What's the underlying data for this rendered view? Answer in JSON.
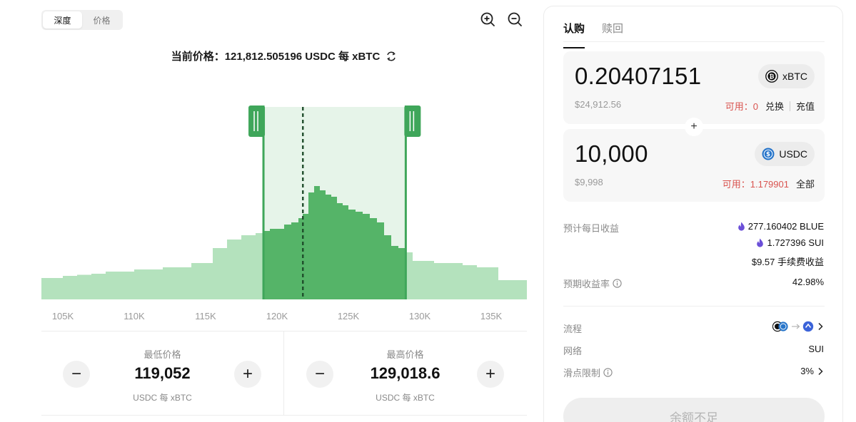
{
  "view_toggle": {
    "options": [
      "深度",
      "价格"
    ],
    "active": "深度"
  },
  "zoom": {
    "in_icon": "zoom-in-icon",
    "out_icon": "zoom-out-icon"
  },
  "current_price": {
    "text": "当前价格：121,812.505196 USDC 每 xBTC",
    "icon": "swap-arrows-icon"
  },
  "chart_data": {
    "type": "area",
    "x_ticks": [
      "105K",
      "110K",
      "115K",
      "120K",
      "125K",
      "130K",
      "135K"
    ],
    "xlim": [
      103500,
      137500
    ],
    "selected_range": [
      119052,
      129018.6
    ],
    "current_price": 121812.505196,
    "colors": {
      "outside": "#b4e2bd",
      "inside": "#55b468",
      "handle": "#3fa65a",
      "band": "#e6f4e9",
      "current_line": "#1f4d2b"
    },
    "depth": {
      "x": [
        103500,
        105000,
        106000,
        107000,
        108000,
        110000,
        112000,
        114000,
        115500,
        116500,
        117500,
        118500,
        119000,
        119500,
        120000,
        120500,
        121000,
        121500,
        121800,
        122200,
        122600,
        123000,
        123400,
        123800,
        124200,
        124600,
        125000,
        125500,
        126000,
        126500,
        127000,
        127500,
        128000,
        128500,
        129000,
        129500,
        131000,
        133000,
        134000,
        135500,
        137500
      ],
      "y": [
        10,
        11,
        11.5,
        12,
        13,
        14,
        15,
        17,
        24,
        28,
        30,
        31,
        32,
        33,
        33,
        35,
        36,
        38,
        40,
        50,
        53,
        51,
        49,
        48,
        45,
        44,
        42,
        41,
        40,
        38,
        36,
        30,
        25,
        24,
        22,
        18,
        17,
        16,
        15,
        9,
        9
      ]
    }
  },
  "min_price": {
    "label": "最低价格",
    "value": "119,052",
    "unit": "USDC 每 xBTC",
    "minus": "−",
    "plus": "+"
  },
  "max_price": {
    "label": "最高价格",
    "value": "129,018.6",
    "unit": "USDC 每 xBTC",
    "minus": "−",
    "plus": "+"
  },
  "panel": {
    "tabs": [
      "认购",
      "赎回"
    ],
    "active_tab": "认购",
    "token_a": {
      "amount": "0.20407151",
      "usd": "$24,912.56",
      "symbol": "xBTC",
      "icon": "xbtc-token-icon",
      "avail_label": "可用：0",
      "links": [
        "兑换",
        "充值"
      ]
    },
    "plus": "+",
    "token_b": {
      "amount": "10,000",
      "usd": "$9,998",
      "symbol": "USDC",
      "icon": "usdc-token-icon",
      "avail_label": "可用：1.179901",
      "link": "全部"
    },
    "daily_yield": {
      "label": "预计每日收益",
      "lines": [
        "277.160402 BLUE",
        "1.727396 SUI",
        "$9.57 手续费收益"
      ]
    },
    "apr": {
      "label": "预期收益率",
      "value": "42.98%"
    },
    "flow": {
      "label": "流程"
    },
    "network": {
      "label": "网络",
      "value": "SUI"
    },
    "slippage": {
      "label": "滑点限制",
      "value": "3%"
    },
    "submit_label": "余额不足",
    "accent_red": "#d9534f",
    "flame_color": "#6b4fd8"
  }
}
